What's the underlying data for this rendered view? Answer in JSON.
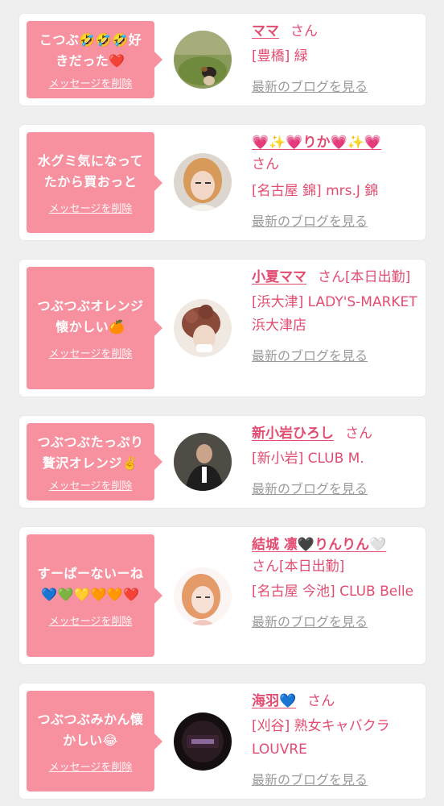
{
  "messages": [
    {
      "message": "こつぶ🤣🤣🤣好きだった❤️",
      "delete_label": "メッセージを削除",
      "name": "ママ",
      "suffix": "さん",
      "shop": "[豊橋] 緑",
      "blog_label": "最新のブログを見る",
      "avatar": "dog-on-grass-photo"
    },
    {
      "message": "水グミ気になってたから買おっと",
      "delete_label": "メッセージを削除",
      "name": "💗✨💗りか💗✨💗",
      "suffix": "さん",
      "shop": "[名古屋 錦] mrs.J 錦",
      "blog_label": "最新のブログを見る",
      "avatar": "blonde-woman-photo"
    },
    {
      "message": "つぶつぶオレンジ懐かしい🍊",
      "delete_label": "メッセージを削除",
      "name": "小夏ママ",
      "suffix": "さん[本日出勤]",
      "shop": "[浜大津] LADY'S-MARKET 浜大津店",
      "blog_label": "最新のブログを見る",
      "avatar": "curly-hair-woman-photo"
    },
    {
      "message": "つぶつぶたっぷり贅沢オレンジ✌️",
      "delete_label": "メッセージを削除",
      "name": "新小岩ひろし",
      "suffix": "さん",
      "shop": "[新小岩] CLUB M.",
      "blog_label": "最新のブログを見る",
      "avatar": "man-in-suit-photo"
    },
    {
      "message": "すーぱーないーね💙💚💛🧡🧡❤️",
      "delete_label": "メッセージを削除",
      "name": "結城 凛🖤りんりん🤍",
      "suffix": "さん[本日出勤]",
      "shop": "[名古屋 今池] CLUB Belle",
      "blog_label": "最新のブログを見る",
      "avatar": "orange-hair-woman-photo"
    },
    {
      "message": "つぶつぶみかん懐かしい😂",
      "delete_label": "メッセージを削除",
      "name": "海羽💙",
      "suffix": "さん",
      "shop": "[刈谷] 熟女キャバクラ LOUVRE",
      "blog_label": "最新のブログを見る",
      "avatar": "louvre-logo"
    }
  ],
  "colors": {
    "accent": "#e34c70",
    "bubble": "#f7919f",
    "link_gray": "#9b9b9b",
    "background": "#efefef"
  }
}
